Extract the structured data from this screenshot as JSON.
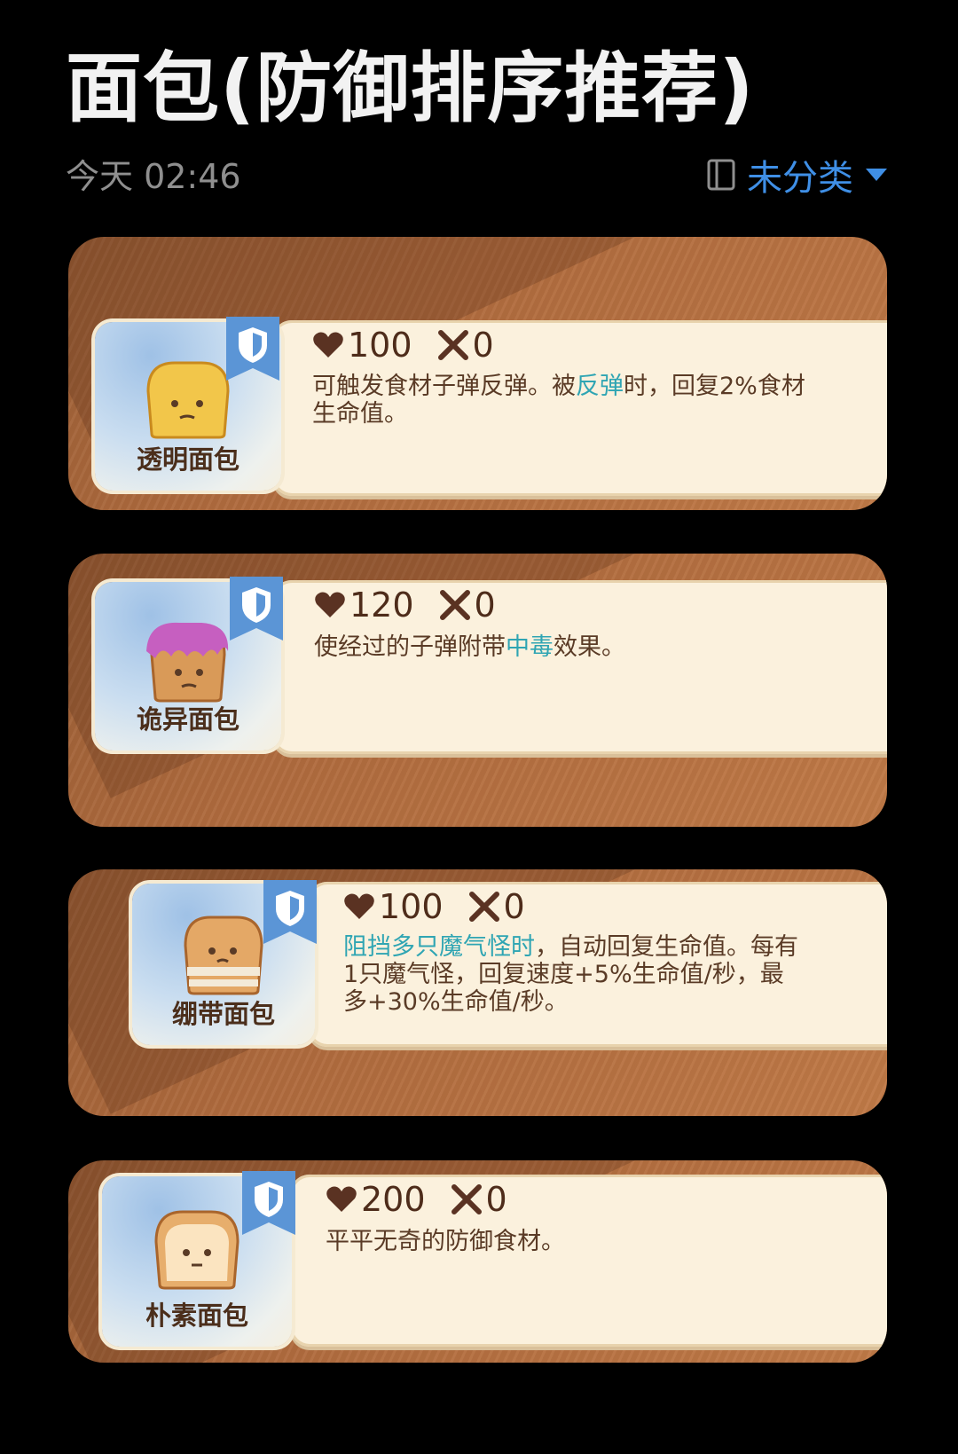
{
  "header": {
    "title": "面包(防御排序推荐)",
    "date": "今天 02:46",
    "category": "未分类"
  },
  "items": [
    {
      "name": "透明面包",
      "hp": "100",
      "atk": "0",
      "desc_parts": [
        "可触发食材子弹反弹。被",
        "反弹",
        "时，回复2%食材生命值。"
      ],
      "bread_color": "#f2c64a"
    },
    {
      "name": "诡异面包",
      "hp": "120",
      "atk": "0",
      "desc_parts": [
        "使经过的子弹附带",
        "中毒",
        "效果。"
      ],
      "bread_color": "#d99a58"
    },
    {
      "name": "绷带面包",
      "hp": "100",
      "atk": "0",
      "desc_parts": [
        "",
        "阻挡多只魔气怪时",
        "，自动回复生命值。每有1只魔气怪，回复速度+5%生命值/秒，最多+30%生命值/秒。"
      ],
      "bread_color": "#e4a866"
    },
    {
      "name": "朴素面包",
      "hp": "200",
      "atk": "0",
      "desc_parts": [
        "平平无奇的防御食材。"
      ],
      "bread_color": "#e7ae6c"
    }
  ],
  "colors": {
    "accent": "#3f8fe6",
    "highlight": "#2fa5b3",
    "card": "#b06b3e",
    "panel": "#fbf1dd"
  }
}
